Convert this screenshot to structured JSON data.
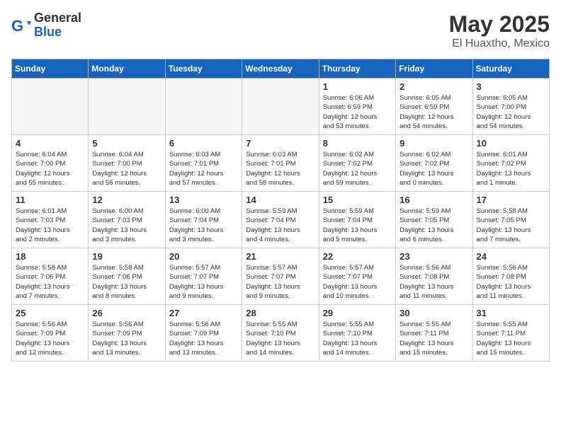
{
  "header": {
    "logo_general": "General",
    "logo_blue": "Blue",
    "month": "May 2025",
    "location": "El Huaxtho, Mexico"
  },
  "days_of_week": [
    "Sunday",
    "Monday",
    "Tuesday",
    "Wednesday",
    "Thursday",
    "Friday",
    "Saturday"
  ],
  "weeks": [
    [
      {
        "day": "",
        "info": "",
        "empty": true
      },
      {
        "day": "",
        "info": "",
        "empty": true
      },
      {
        "day": "",
        "info": "",
        "empty": true
      },
      {
        "day": "",
        "info": "",
        "empty": true
      },
      {
        "day": "1",
        "info": "Sunrise: 6:06 AM\nSunset: 6:59 PM\nDaylight: 12 hours\nand 53 minutes."
      },
      {
        "day": "2",
        "info": "Sunrise: 6:05 AM\nSunset: 6:59 PM\nDaylight: 12 hours\nand 54 minutes."
      },
      {
        "day": "3",
        "info": "Sunrise: 6:05 AM\nSunset: 7:00 PM\nDaylight: 12 hours\nand 54 minutes."
      }
    ],
    [
      {
        "day": "4",
        "info": "Sunrise: 6:04 AM\nSunset: 7:00 PM\nDaylight: 12 hours\nand 55 minutes."
      },
      {
        "day": "5",
        "info": "Sunrise: 6:04 AM\nSunset: 7:00 PM\nDaylight: 12 hours\nand 56 minutes."
      },
      {
        "day": "6",
        "info": "Sunrise: 6:03 AM\nSunset: 7:01 PM\nDaylight: 12 hours\nand 57 minutes."
      },
      {
        "day": "7",
        "info": "Sunrise: 6:03 AM\nSunset: 7:01 PM\nDaylight: 12 hours\nand 58 minutes."
      },
      {
        "day": "8",
        "info": "Sunrise: 6:02 AM\nSunset: 7:02 PM\nDaylight: 12 hours\nand 59 minutes."
      },
      {
        "day": "9",
        "info": "Sunrise: 6:02 AM\nSunset: 7:02 PM\nDaylight: 13 hours\nand 0 minutes."
      },
      {
        "day": "10",
        "info": "Sunrise: 6:01 AM\nSunset: 7:02 PM\nDaylight: 13 hours\nand 1 minute."
      }
    ],
    [
      {
        "day": "11",
        "info": "Sunrise: 6:01 AM\nSunset: 7:03 PM\nDaylight: 13 hours\nand 2 minutes."
      },
      {
        "day": "12",
        "info": "Sunrise: 6:00 AM\nSunset: 7:03 PM\nDaylight: 13 hours\nand 3 minutes."
      },
      {
        "day": "13",
        "info": "Sunrise: 6:00 AM\nSunset: 7:04 PM\nDaylight: 13 hours\nand 3 minutes."
      },
      {
        "day": "14",
        "info": "Sunrise: 5:59 AM\nSunset: 7:04 PM\nDaylight: 13 hours\nand 4 minutes."
      },
      {
        "day": "15",
        "info": "Sunrise: 5:59 AM\nSunset: 7:04 PM\nDaylight: 13 hours\nand 5 minutes."
      },
      {
        "day": "16",
        "info": "Sunrise: 5:59 AM\nSunset: 7:05 PM\nDaylight: 13 hours\nand 6 minutes."
      },
      {
        "day": "17",
        "info": "Sunrise: 5:58 AM\nSunset: 7:05 PM\nDaylight: 13 hours\nand 7 minutes."
      }
    ],
    [
      {
        "day": "18",
        "info": "Sunrise: 5:58 AM\nSunset: 7:06 PM\nDaylight: 13 hours\nand 7 minutes."
      },
      {
        "day": "19",
        "info": "Sunrise: 5:58 AM\nSunset: 7:06 PM\nDaylight: 13 hours\nand 8 minutes."
      },
      {
        "day": "20",
        "info": "Sunrise: 5:57 AM\nSunset: 7:07 PM\nDaylight: 13 hours\nand 9 minutes."
      },
      {
        "day": "21",
        "info": "Sunrise: 5:57 AM\nSunset: 7:07 PM\nDaylight: 13 hours\nand 9 minutes."
      },
      {
        "day": "22",
        "info": "Sunrise: 5:57 AM\nSunset: 7:07 PM\nDaylight: 13 hours\nand 10 minutes."
      },
      {
        "day": "23",
        "info": "Sunrise: 5:56 AM\nSunset: 7:08 PM\nDaylight: 13 hours\nand 11 minutes."
      },
      {
        "day": "24",
        "info": "Sunrise: 5:56 AM\nSunset: 7:08 PM\nDaylight: 13 hours\nand 11 minutes."
      }
    ],
    [
      {
        "day": "25",
        "info": "Sunrise: 5:56 AM\nSunset: 7:09 PM\nDaylight: 13 hours\nand 12 minutes."
      },
      {
        "day": "26",
        "info": "Sunrise: 5:56 AM\nSunset: 7:09 PM\nDaylight: 13 hours\nand 13 minutes."
      },
      {
        "day": "27",
        "info": "Sunrise: 5:56 AM\nSunset: 7:09 PM\nDaylight: 13 hours\nand 13 minutes."
      },
      {
        "day": "28",
        "info": "Sunrise: 5:55 AM\nSunset: 7:10 PM\nDaylight: 13 hours\nand 14 minutes."
      },
      {
        "day": "29",
        "info": "Sunrise: 5:55 AM\nSunset: 7:10 PM\nDaylight: 13 hours\nand 14 minutes."
      },
      {
        "day": "30",
        "info": "Sunrise: 5:55 AM\nSunset: 7:11 PM\nDaylight: 13 hours\nand 15 minutes."
      },
      {
        "day": "31",
        "info": "Sunrise: 5:55 AM\nSunset: 7:11 PM\nDaylight: 13 hours\nand 15 minutes."
      }
    ]
  ]
}
